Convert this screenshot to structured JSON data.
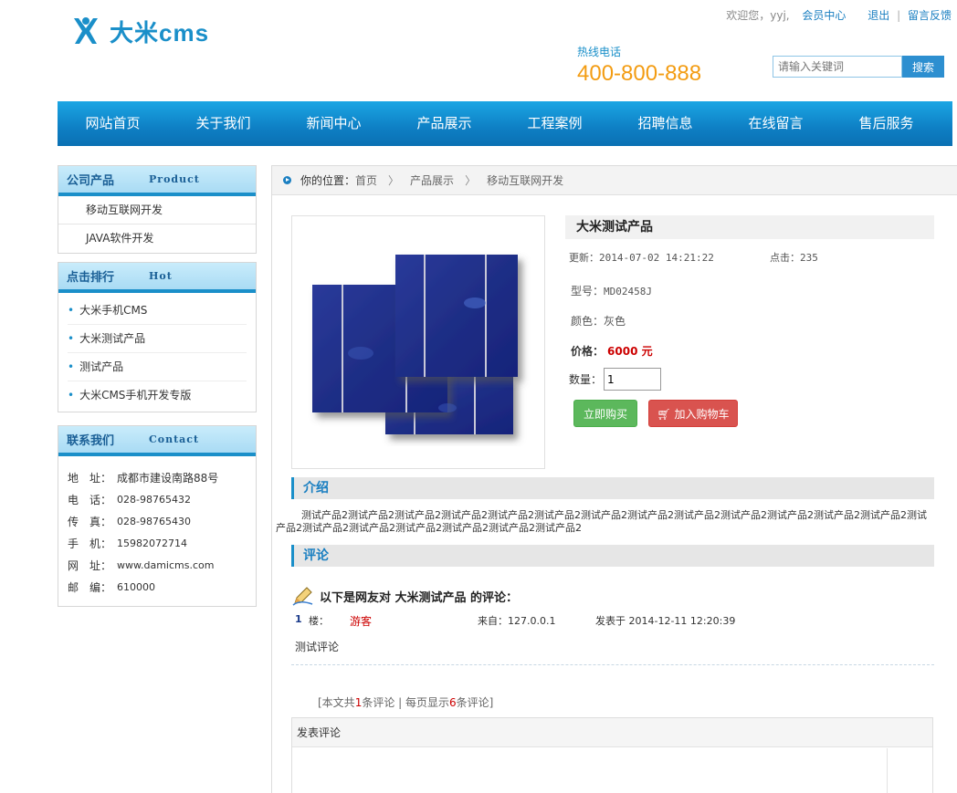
{
  "header": {
    "brand": "大米cms",
    "welcome": "欢迎您，yyj,",
    "member_center": "会员中心",
    "logout": "退出",
    "feedback": "留言反馈",
    "hotline_label": "热线电话",
    "hotline_number": "400-800-888",
    "search_placeholder": "请输入关键词",
    "search_button": "搜索"
  },
  "nav": [
    "网站首页",
    "关于我们",
    "新闻中心",
    "产品展示",
    "工程案例",
    "招聘信息",
    "在线留言",
    "售后服务"
  ],
  "sidebar": {
    "products": {
      "title": "公司产品",
      "title_en": "Product",
      "items": [
        "移动互联网开发",
        "JAVA软件开发"
      ]
    },
    "hot": {
      "title": "点击排行",
      "title_en": "Hot",
      "items": [
        "大米手机CMS",
        "大米测试产品",
        "测试产品",
        "大米CMS手机开发专版"
      ]
    },
    "contact": {
      "title": "联系我们",
      "title_en": "Contact",
      "rows": [
        {
          "k": "地　址：",
          "v": "成都市建设南路88号"
        },
        {
          "k": "电　话：",
          "v": "028-98765432"
        },
        {
          "k": "传　真：",
          "v": "028-98765430"
        },
        {
          "k": "手　机：",
          "v": "15982072714"
        },
        {
          "k": "网　址：",
          "v": "www.damicms.com"
        },
        {
          "k": "邮　编：",
          "v": "610000"
        }
      ]
    }
  },
  "breadcrumb": {
    "label": "你的位置：",
    "items": [
      "首页",
      "产品展示",
      "移动互联网开发"
    ],
    "arrow": "〉"
  },
  "product": {
    "name": "大米测试产品",
    "updated_label": "更新：",
    "updated": "2014-07-02 14:21:22",
    "clicks_label": "点击：",
    "clicks": "235",
    "model_label": "型号：",
    "model": "MD02458J",
    "color_label": "颜色：",
    "color": "灰色",
    "price_label": "价格：",
    "price": "6000 元",
    "qty_label": "数量：",
    "qty": "1",
    "buy_button": "立即购买",
    "cart_button": "加入购物车"
  },
  "intro": {
    "title": "介绍",
    "text": "测试产品2测试产品2测试产品2测试产品2测试产品2测试产品2测试产品2测试产品2测试产品2测试产品2测试产品2测试产品2测试产品2测试产品2测试产品2测试产品2测试产品2测试产品2测试产品2测试产品2"
  },
  "comments": {
    "title": "评论",
    "heading": "以下是网友对 大米测试产品 的评论：",
    "floor": "1",
    "floor_suffix": "楼：",
    "user": "游客",
    "from": "来自：127.0.0.1",
    "posted": "发表于 2014-12-11 12:20:39",
    "body": "测试评论",
    "pager_pre": "[本文共",
    "total": "1",
    "pager_mid": "条评论 | 每页显示",
    "per_page": "6",
    "pager_post": "条评论]",
    "post_title": "发表评论"
  },
  "colors": {
    "accent": "#1a8fc9",
    "hotline": "#f39c12",
    "price": "#cc0000",
    "buy": "#5cb85c",
    "cart": "#d9534f"
  }
}
